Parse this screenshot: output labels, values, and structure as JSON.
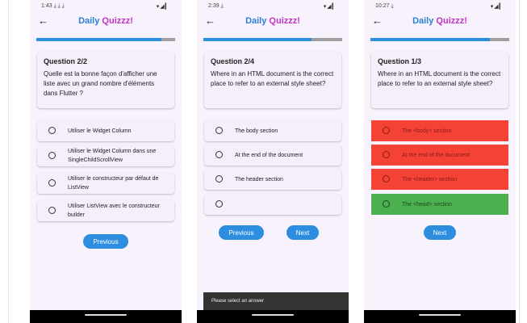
{
  "screens": [
    {
      "time": "1:43",
      "status_extra": "⤓ ⤓ ⤓",
      "status_icons": "▾◢▎",
      "app_title_part1": "Daily",
      "app_title_part2": "Quizzz!",
      "progress": 0.9,
      "question_number": "Question 2/2",
      "question_text": "Quelle est la bonne façon d'afficher une liste avec un grand nombre d'éléments dans Flutter ?",
      "options": [
        "Utiliser le Widget Column",
        "Utiliser le Widget Column dans une SingleChildScrollView",
        "Utiliser le constructeur par défaut de ListView",
        "Utiliser ListView avec le constructeur builder"
      ],
      "previous_label": "Previous"
    },
    {
      "time": "2:39",
      "status_extra": "⤓",
      "status_icons": "▾◢▎",
      "app_title_part1": "Daily",
      "app_title_part2": "Quizzz!",
      "progress": 0.78,
      "question_number": "Question 2/4",
      "question_text": "Where in an HTML document is the correct place to refer to an external style sheet?",
      "options": [
        "The body section",
        "At the end of the document",
        "The header section",
        ""
      ],
      "previous_label": "Previous",
      "next_label": "Next",
      "snackbar": "Please select an answer"
    },
    {
      "time": "10:27",
      "status_extra": "⤓",
      "status_icons": "▾◢▎",
      "app_title_part1": "Daily",
      "app_title_part2": "Quizzz!",
      "progress": 0.86,
      "question_number": "Question 1/3",
      "question_text": "Where in an HTML document is the correct place to refer to an external style sheet?",
      "options": [
        "The <body> section",
        "At the end of the document",
        "The <header> section",
        "The <head> section"
      ],
      "next_label": "Next"
    }
  ],
  "colors": {
    "accent": "#2d8ee0",
    "title_blue": "#2a7fd6",
    "title_magenta": "#c234c2",
    "wrong": "#f44336",
    "correct": "#4caf50",
    "background": "#f7f2fb"
  }
}
